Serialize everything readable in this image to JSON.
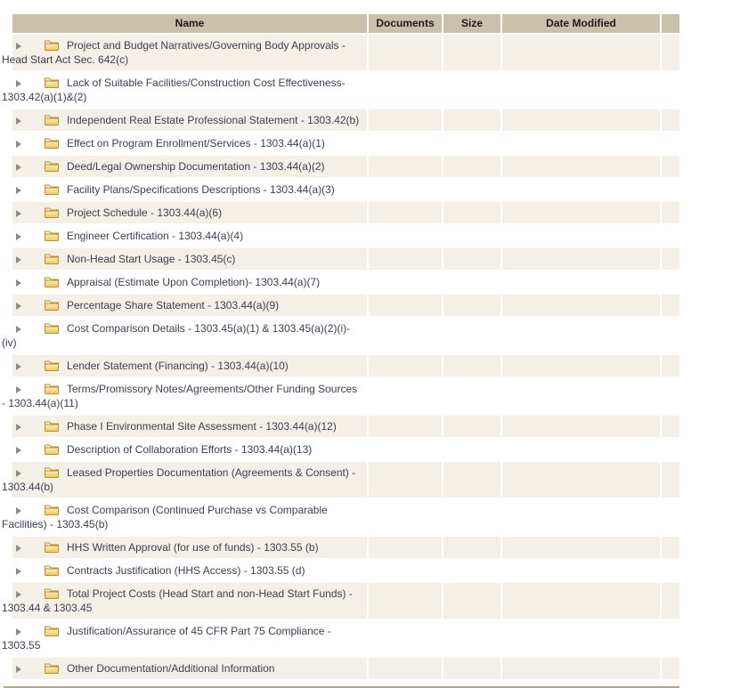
{
  "table": {
    "header": {
      "name": "Name",
      "documents": "Documents",
      "size": "Size",
      "date_modified": "Date Modified",
      "actions": ""
    },
    "rows": [
      {
        "name": "Project and Budget Narratives/Governing Body Approvals - Head Start Act Sec. 642(c)",
        "documents": "",
        "size": "",
        "date_modified": ""
      },
      {
        "name": "Lack of Suitable Facilities/Construction Cost Effectiveness- 1303.42(a)(1)&(2)",
        "documents": "",
        "size": "",
        "date_modified": ""
      },
      {
        "name": "Independent Real Estate Professional Statement - 1303.42(b)",
        "documents": "",
        "size": "",
        "date_modified": ""
      },
      {
        "name": "Effect on Program Enrollment/Services - 1303.44(a)(1)",
        "documents": "",
        "size": "",
        "date_modified": ""
      },
      {
        "name": "Deed/Legal Ownership Documentation - 1303.44(a)(2)",
        "documents": "",
        "size": "",
        "date_modified": ""
      },
      {
        "name": "Facility Plans/Specifications Descriptions - 1303.44(a)(3)",
        "documents": "",
        "size": "",
        "date_modified": ""
      },
      {
        "name": "Project Schedule - 1303.44(a)(6)",
        "documents": "",
        "size": "",
        "date_modified": ""
      },
      {
        "name": "Engineer Certification - 1303.44(a)(4)",
        "documents": "",
        "size": "",
        "date_modified": ""
      },
      {
        "name": "Non-Head Start Usage - 1303.45(c)",
        "documents": "",
        "size": "",
        "date_modified": ""
      },
      {
        "name": "Appraisal (Estimate Upon Completion)- 1303.44(a)(7)",
        "documents": "",
        "size": "",
        "date_modified": ""
      },
      {
        "name": "Percentage Share Statement - 1303.44(a)(9)",
        "documents": "",
        "size": "",
        "date_modified": ""
      },
      {
        "name": "Cost Comparison Details - 1303.45(a)(1) & 1303.45(a)(2)(i)-(iv)",
        "documents": "",
        "size": "",
        "date_modified": ""
      },
      {
        "name": "Lender Statement (Financing) - 1303.44(a)(10)",
        "documents": "",
        "size": "",
        "date_modified": ""
      },
      {
        "name": "Terms/Promissory Notes/Agreements/Other Funding Sources - 1303.44(a)(11)",
        "documents": "",
        "size": "",
        "date_modified": ""
      },
      {
        "name": "Phase I Environmental Site Assessment - 1303.44(a)(12)",
        "documents": "",
        "size": "",
        "date_modified": ""
      },
      {
        "name": "Description of Collaboration Efforts - 1303.44(a)(13)",
        "documents": "",
        "size": "",
        "date_modified": ""
      },
      {
        "name": "Leased Properties Documentation (Agreements & Consent) - 1303.44(b)",
        "documents": "",
        "size": "",
        "date_modified": ""
      },
      {
        "name": "Cost Comparison (Continued Purchase vs Comparable Facilities) - 1303.45(b)",
        "documents": "",
        "size": "",
        "date_modified": ""
      },
      {
        "name": "HHS Written Approval (for use of funds) - 1303.55 (b)",
        "documents": "",
        "size": "",
        "date_modified": ""
      },
      {
        "name": "Contracts Justification (HHS Access) - 1303.55 (d)",
        "documents": "",
        "size": "",
        "date_modified": ""
      },
      {
        "name": "Total Project Costs (Head Start and non-Head Start Funds) - 1303.44 & 1303.45",
        "documents": "",
        "size": "",
        "date_modified": ""
      },
      {
        "name": "Justification/Assurance of 45 CFR Part 75 Compliance - 1303.55",
        "documents": "",
        "size": "",
        "date_modified": ""
      },
      {
        "name": "Other Documentation/Additional Information",
        "documents": "",
        "size": "",
        "date_modified": ""
      }
    ],
    "icons": {
      "expander": "right-triangle-icon",
      "folder": "closed-folder-icon"
    },
    "colors": {
      "header_bg": "#c9c1ac",
      "header_text": "#1b1b1b",
      "row_alt_bg": "#f4f0e7",
      "row_bg": "#ffffff",
      "row_text": "#3d3d52",
      "bottom_rule": "#b3a78e",
      "expander_arrow": "#8b8b8b",
      "folder_outline": "#b5922f"
    }
  }
}
